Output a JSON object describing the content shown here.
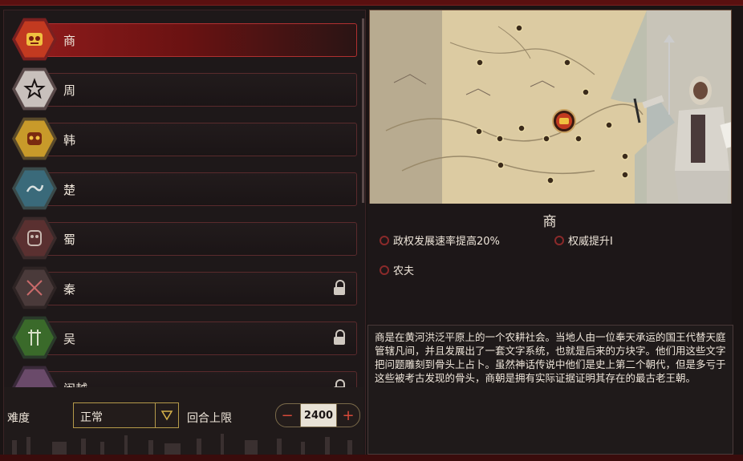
{
  "factions": [
    {
      "label": "商",
      "icon": "shang-mask-icon",
      "color": "#c23a20",
      "locked": false,
      "selected": true
    },
    {
      "label": "周",
      "icon": "zhou-star-icon",
      "color": "#c8c0bc",
      "locked": false,
      "selected": false
    },
    {
      "label": "韩",
      "icon": "han-mask-icon",
      "color": "#c89a2a",
      "locked": false,
      "selected": false
    },
    {
      "label": "楚",
      "icon": "chu-dragon-icon",
      "color": "#3a6a7a",
      "locked": false,
      "selected": false
    },
    {
      "label": "蜀",
      "icon": "shu-mask-icon",
      "color": "#5a3030",
      "locked": false,
      "selected": false
    },
    {
      "label": "秦",
      "icon": "qin-spears-icon",
      "color": "#4a3a3a",
      "locked": true,
      "selected": false
    },
    {
      "label": "吴",
      "icon": "wu-swords-icon",
      "color": "#3a6a2a",
      "locked": true,
      "selected": false
    },
    {
      "label": "闽越",
      "icon": "minyue-icon",
      "color": "#6a4a6a",
      "locked": true,
      "selected": false
    }
  ],
  "controls": {
    "difficulty_label": "难度",
    "difficulty_value": "正常",
    "turn_limit_label": "回合上限",
    "turn_limit_value": "2400",
    "minus": "−",
    "plus": "+"
  },
  "info": {
    "title": "商",
    "effects": [
      "政权发展速率提高20%",
      "权威提升I",
      "农夫"
    ],
    "description": "商是在黄河洪泛平原上的一个农耕社会。当地人由一位奉天承运的国王代替天庭管辖凡间，并且发展出了一套文字系统，也就是后来的方块字。他们用这些文字把问题雕刻到骨头上占卜。虽然神话传说中他们是史上第二个朝代，但是多亏于这些被考古发现的骨头，商朝是拥有实际证据证明其存在的最古老王朝。"
  },
  "map": {
    "capital_icon": "shang-capital-icon",
    "soldier": "shang-soldier-portrait"
  }
}
